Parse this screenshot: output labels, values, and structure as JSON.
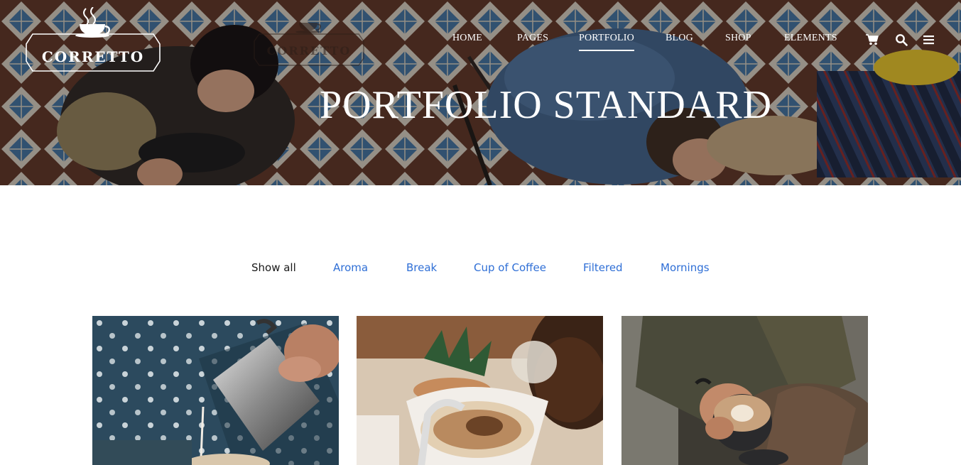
{
  "brand": {
    "name": "CORRETTO"
  },
  "nav": {
    "items": [
      {
        "label": "HOME",
        "active": false
      },
      {
        "label": "PAGES",
        "active": false
      },
      {
        "label": "PORTFOLIO",
        "active": true
      },
      {
        "label": "BLOG",
        "active": false
      },
      {
        "label": "SHOP",
        "active": false
      },
      {
        "label": "ELEMENTS",
        "active": false
      }
    ],
    "icons": [
      "cart-icon",
      "search-icon",
      "menu-icon"
    ]
  },
  "hero": {
    "title": "PORTFOLIO STANDARD"
  },
  "filters": {
    "items": [
      {
        "label": "Show all",
        "active": true
      },
      {
        "label": "Aroma",
        "active": false
      },
      {
        "label": "Break",
        "active": false
      },
      {
        "label": "Cup of Coffee",
        "active": false
      },
      {
        "label": "Filtered",
        "active": false
      },
      {
        "label": "Mornings",
        "active": false
      }
    ]
  },
  "portfolio": {
    "items": [
      {
        "image": "latte-art-pour-photo"
      },
      {
        "image": "pour-over-coffee-photo"
      },
      {
        "image": "latte-cup-in-hands-photo"
      }
    ]
  },
  "colors": {
    "accent_link": "#2f6fd6",
    "active_text": "#1a1a1a",
    "nav_text": "#ffffff"
  }
}
